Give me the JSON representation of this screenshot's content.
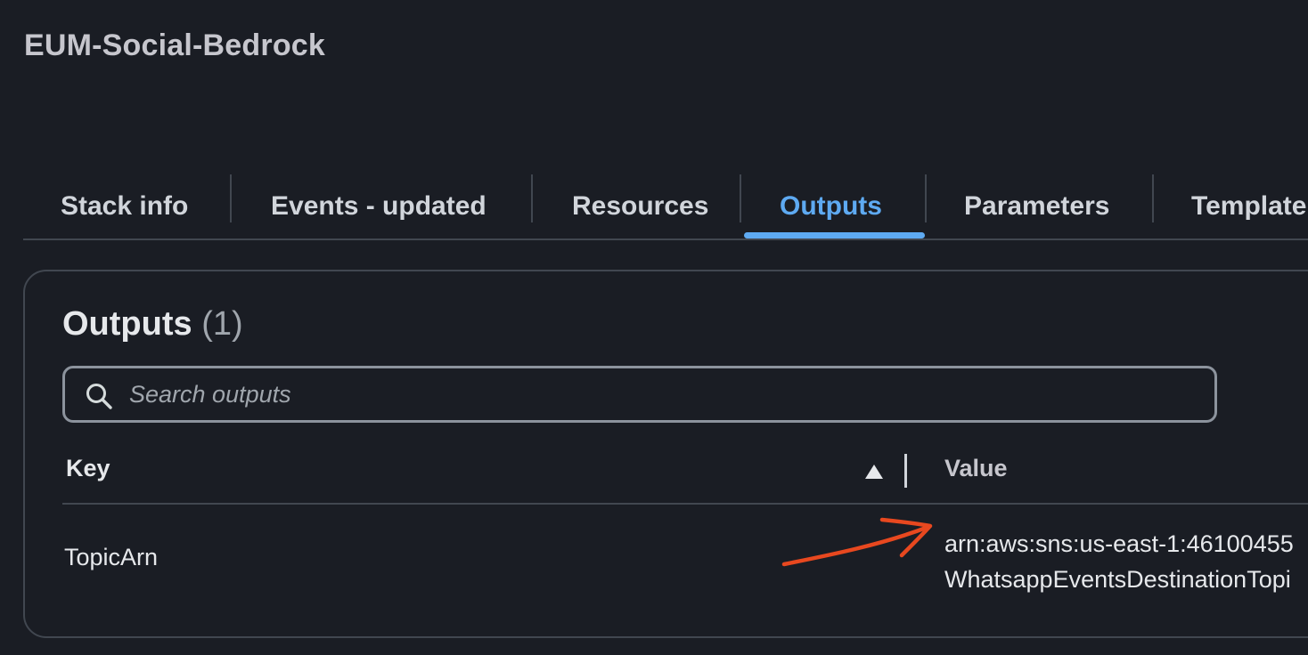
{
  "stack": {
    "title": "EUM-Social-Bedrock"
  },
  "tabs": [
    {
      "label": "Stack info",
      "active": false
    },
    {
      "label": "Events - updated",
      "active": false
    },
    {
      "label": "Resources",
      "active": false
    },
    {
      "label": "Outputs",
      "active": true
    },
    {
      "label": "Parameters",
      "active": false
    },
    {
      "label": "Template",
      "active": false
    }
  ],
  "outputs": {
    "title": "Outputs",
    "count": "(1)",
    "search": {
      "placeholder": "Search outputs",
      "value": ""
    },
    "columns": {
      "key": "Key",
      "value": "Value"
    },
    "sort": {
      "column": "Key",
      "direction": "ascending",
      "icon": "caret-up-icon"
    },
    "rows": [
      {
        "key": "TopicArn",
        "value_line1": "arn:aws:sns:us-east-1:46100455",
        "value_line2": "WhatsappEventsDestinationTopi"
      }
    ]
  },
  "annotation": {
    "type": "arrow",
    "color": "#e8481f",
    "points_to": "value-cell"
  },
  "colors": {
    "background": "#1a1d24",
    "accent": "#5eaaf2",
    "border": "#414750",
    "text": "#e6e8eb"
  }
}
